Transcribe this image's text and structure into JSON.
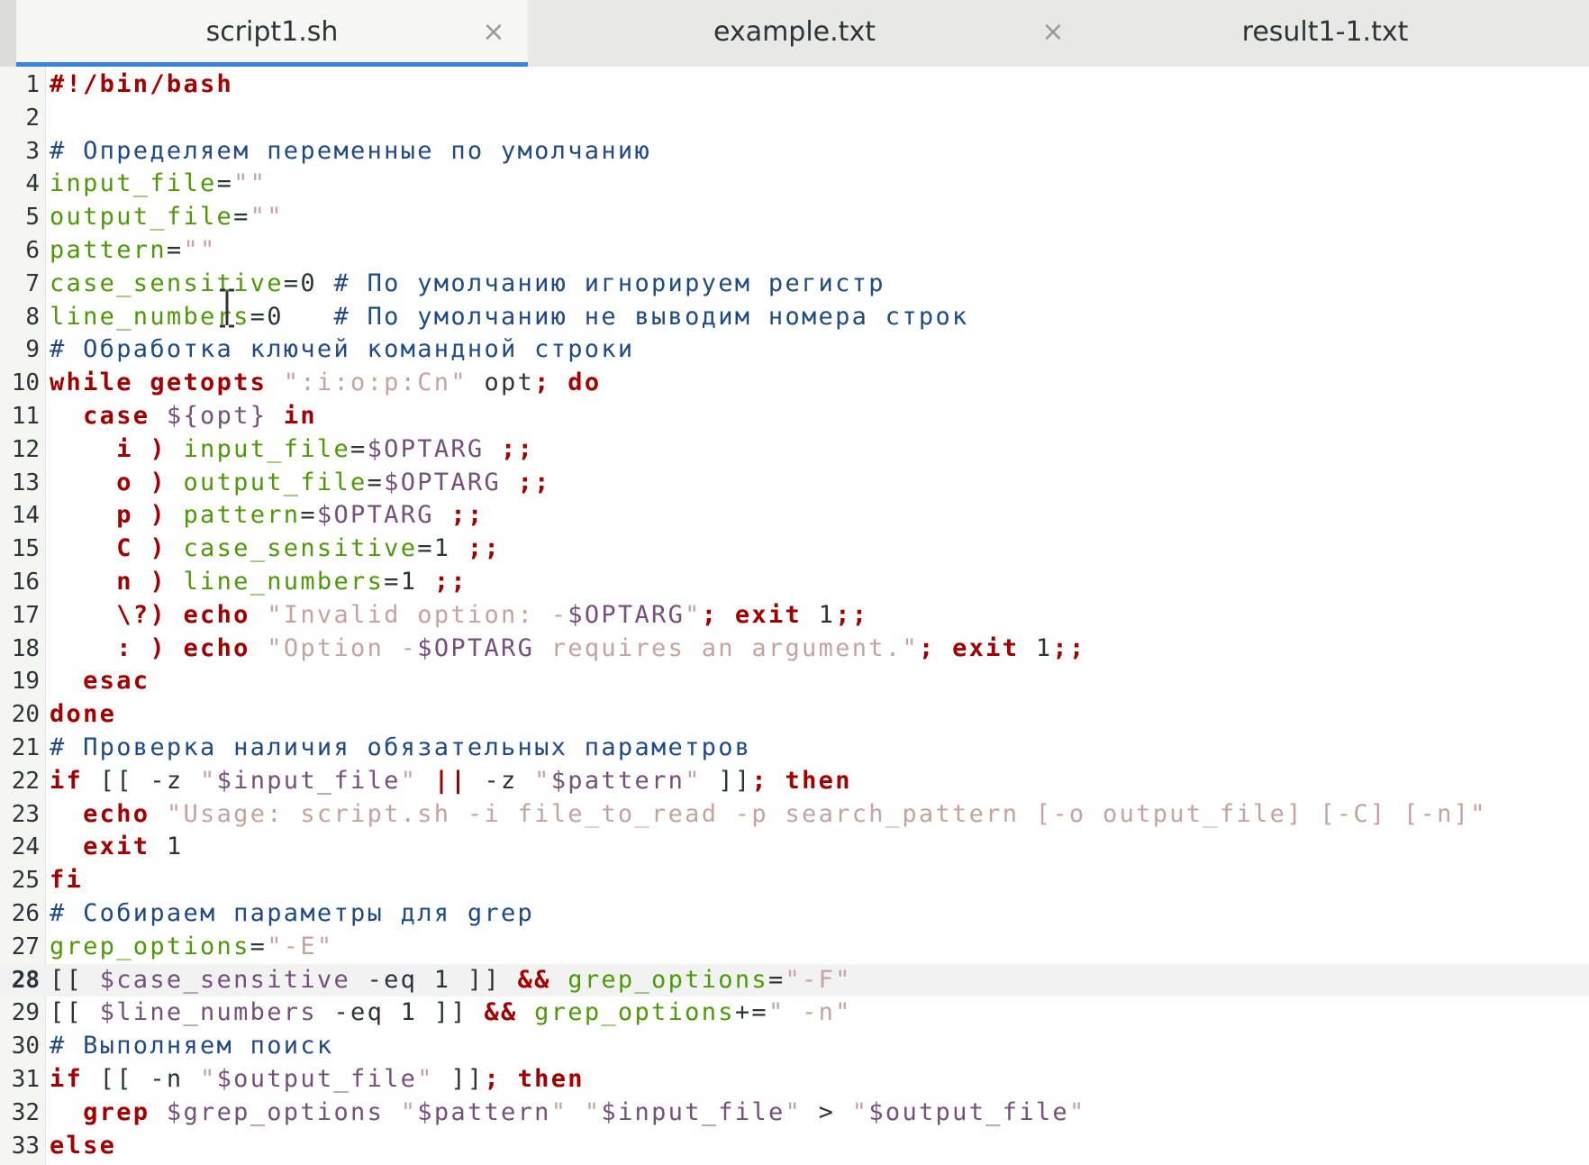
{
  "tabs": [
    {
      "title": "script1.sh",
      "active": true,
      "close": "×"
    },
    {
      "title": "example.txt",
      "active": false,
      "close": "×"
    },
    {
      "title": "result1-1.txt",
      "active": false
    }
  ],
  "editor": {
    "current_line": 28,
    "lines": [
      {
        "n": "1",
        "text": "#!/bin/bash"
      },
      {
        "n": "2",
        "text": ""
      },
      {
        "n": "3",
        "text": "# Определяем переменные по умолчанию"
      },
      {
        "n": "4",
        "text": "input_file=\"\""
      },
      {
        "n": "5",
        "text": "output_file=\"\""
      },
      {
        "n": "6",
        "text": "pattern=\"\""
      },
      {
        "n": "7",
        "text": "case_sensitive=0 # По умолчанию игнорируем регистр"
      },
      {
        "n": "8",
        "text": "line_numbers=0   # По умолчанию не выводим номера строк"
      },
      {
        "n": "9",
        "text": "# Обработка ключей командной строки"
      },
      {
        "n": "10",
        "text": "while getopts \":i:o:p:Cn\" opt; do"
      },
      {
        "n": "11",
        "text": "  case ${opt} in"
      },
      {
        "n": "12",
        "text": "    i ) input_file=$OPTARG ;;"
      },
      {
        "n": "13",
        "text": "    o ) output_file=$OPTARG ;;"
      },
      {
        "n": "14",
        "text": "    p ) pattern=$OPTARG ;;"
      },
      {
        "n": "15",
        "text": "    C ) case_sensitive=1 ;;"
      },
      {
        "n": "16",
        "text": "    n ) line_numbers=1 ;;"
      },
      {
        "n": "17",
        "text": "    \\?) echo \"Invalid option: -$OPTARG\"; exit 1;;"
      },
      {
        "n": "18",
        "text": "    : ) echo \"Option -$OPTARG requires an argument.\"; exit 1;;"
      },
      {
        "n": "19",
        "text": "  esac"
      },
      {
        "n": "20",
        "text": "done"
      },
      {
        "n": "21",
        "text": "# Проверка наличия обязательных параметров"
      },
      {
        "n": "22",
        "text": "if [[ -z \"$input_file\" || -z \"$pattern\" ]]; then"
      },
      {
        "n": "23",
        "text": "  echo \"Usage: script.sh -i file_to_read -p search_pattern [-o output_file] [-C] [-n]\""
      },
      {
        "n": "24",
        "text": "  exit 1"
      },
      {
        "n": "25",
        "text": "fi"
      },
      {
        "n": "26",
        "text": "# Собираем параметры для grep"
      },
      {
        "n": "27",
        "text": "grep_options=\"-E\""
      },
      {
        "n": "28",
        "text": "[[ $case_sensitive -eq 1 ]] && grep_options=\"-F\""
      },
      {
        "n": "29",
        "text": "[[ $line_numbers -eq 1 ]] && grep_options+=\" -n\""
      },
      {
        "n": "30",
        "text": "# Выполняем поиск"
      },
      {
        "n": "31",
        "text": "if [[ -n \"$output_file\" ]]; then"
      },
      {
        "n": "32",
        "text": "  grep $grep_options \"$pattern\" \"$input_file\" > \"$output_file\""
      },
      {
        "n": "33",
        "text": "else"
      }
    ]
  }
}
